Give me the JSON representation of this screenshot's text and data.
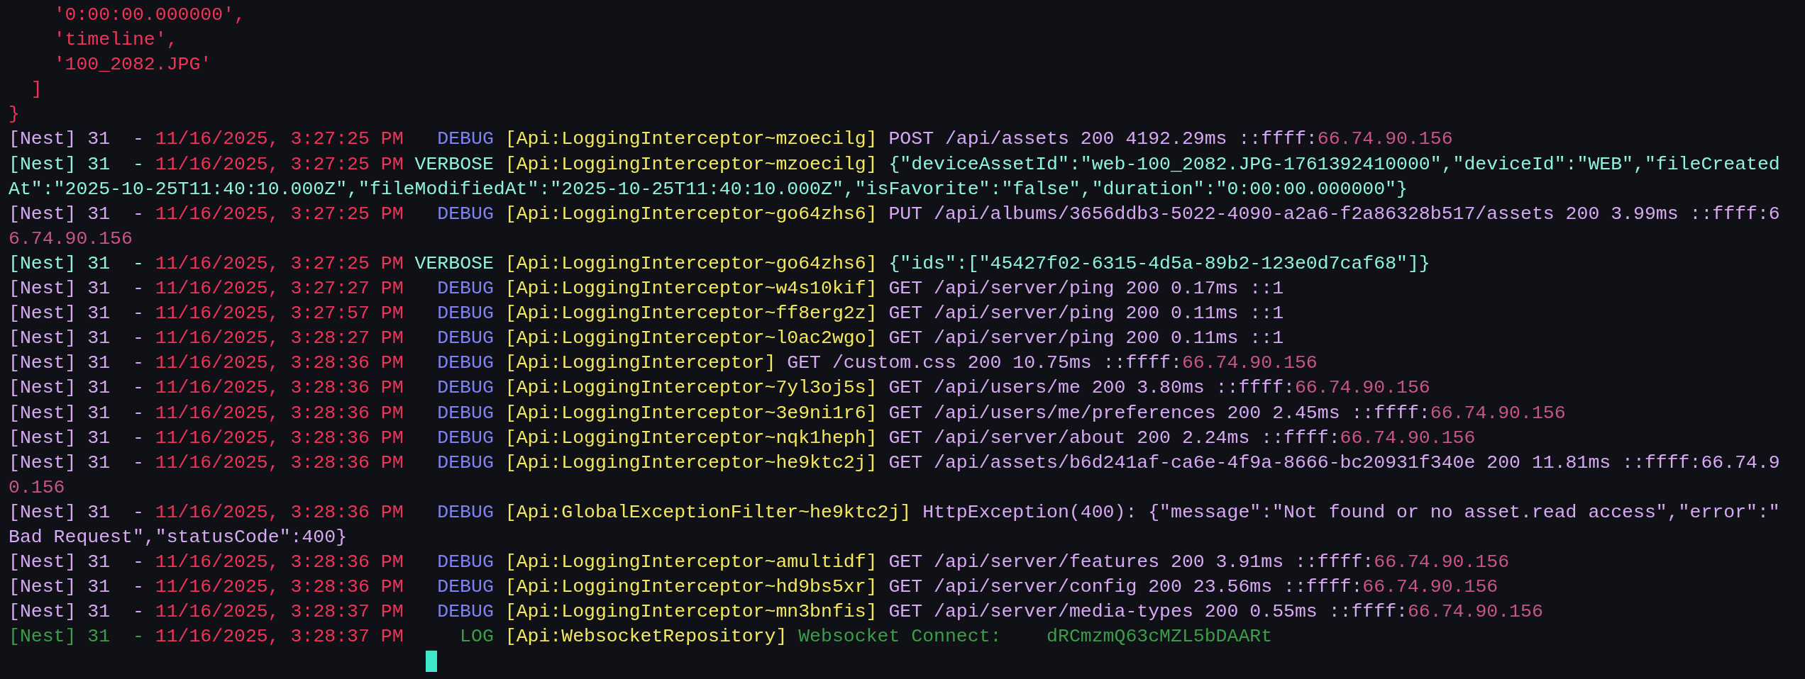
{
  "prelude": [
    "    '0:00:00.000000',",
    "    'timeline',",
    "    '100_2082.JPG'",
    "  ]",
    "}"
  ],
  "entries": [
    {
      "kind": "debug",
      "source": "[Nest] 31  -",
      "timestamp": "11/16/2025, 3:27:25 PM",
      "level": "DEBUG",
      "context": "[Api:LoggingInterceptor~mzoecilg]",
      "message": "POST /api/assets 200 4192.29ms ::ffff:",
      "ip": "66.74.90.156"
    },
    {
      "kind": "verbose",
      "source": "[Nest] 31  -",
      "timestamp": "11/16/2025, 3:27:25 PM",
      "level": "VERBOSE",
      "context": "[Api:LoggingInterceptor~mzoecilg]",
      "message": "{\"deviceAssetId\":\"web-100_2082.JPG-1761392410000\",\"deviceId\":\"WEB\",\"fileCreated",
      "continuation": "At\":\"2025-10-25T11:40:10.000Z\",\"fileModifiedAt\":\"2025-10-25T11:40:10.000Z\",\"isFavorite\":\"false\",\"duration\":\"0:00:00.000000\"}"
    },
    {
      "kind": "debug",
      "source": "[Nest] 31  -",
      "timestamp": "11/16/2025, 3:27:25 PM",
      "level": "DEBUG",
      "context": "[Api:LoggingInterceptor~go64zhs6]",
      "message": "PUT /api/albums/3656ddb3-5022-4090-a2a6-f2a86328b517/assets 200 3.99ms ::ffff:6",
      "ip": "6.74.90.156"
    },
    {
      "kind": "verbose",
      "source": "[Nest] 31  -",
      "timestamp": "11/16/2025, 3:27:25 PM",
      "level": "VERBOSE",
      "context": "[Api:LoggingInterceptor~go64zhs6]",
      "message": "{\"ids\":[\"45427f02-6315-4d5a-89b2-123e0d7caf68\"]}"
    },
    {
      "kind": "debug",
      "source": "[Nest] 31  -",
      "timestamp": "11/16/2025, 3:27:27 PM",
      "level": "DEBUG",
      "context": "[Api:LoggingInterceptor~w4s10kif]",
      "message": "GET /api/server/ping 200 0.17ms ::1"
    },
    {
      "kind": "debug",
      "source": "[Nest] 31  -",
      "timestamp": "11/16/2025, 3:27:57 PM",
      "level": "DEBUG",
      "context": "[Api:LoggingInterceptor~ff8erg2z]",
      "message": "GET /api/server/ping 200 0.11ms ::1"
    },
    {
      "kind": "debug",
      "source": "[Nest] 31  -",
      "timestamp": "11/16/2025, 3:28:27 PM",
      "level": "DEBUG",
      "context": "[Api:LoggingInterceptor~l0ac2wgo]",
      "message": "GET /api/server/ping 200 0.11ms ::1"
    },
    {
      "kind": "debug",
      "source": "[Nest] 31  -",
      "timestamp": "11/16/2025, 3:28:36 PM",
      "level": "DEBUG",
      "context": "[Api:LoggingInterceptor]",
      "message": "GET /custom.css 200 10.75ms ::ffff:",
      "ip": "66.74.90.156"
    },
    {
      "kind": "debug",
      "source": "[Nest] 31  -",
      "timestamp": "11/16/2025, 3:28:36 PM",
      "level": "DEBUG",
      "context": "[Api:LoggingInterceptor~7yl3oj5s]",
      "message": "GET /api/users/me 200 3.80ms ::ffff:",
      "ip": "66.74.90.156"
    },
    {
      "kind": "debug",
      "source": "[Nest] 31  -",
      "timestamp": "11/16/2025, 3:28:36 PM",
      "level": "DEBUG",
      "context": "[Api:LoggingInterceptor~3e9ni1r6]",
      "message": "GET /api/users/me/preferences 200 2.45ms ::ffff:",
      "ip": "66.74.90.156"
    },
    {
      "kind": "debug",
      "source": "[Nest] 31  -",
      "timestamp": "11/16/2025, 3:28:36 PM",
      "level": "DEBUG",
      "context": "[Api:LoggingInterceptor~nqk1heph]",
      "message": "GET /api/server/about 200 2.24ms ::ffff:",
      "ip": "66.74.90.156"
    },
    {
      "kind": "debug",
      "source": "[Nest] 31  -",
      "timestamp": "11/16/2025, 3:28:36 PM",
      "level": "DEBUG",
      "context": "[Api:LoggingInterceptor~he9ktc2j]",
      "message": "GET /api/assets/b6d241af-ca6e-4f9a-8666-bc20931f340e 200 11.81ms ::ffff:66.74.9",
      "ip": "0.156"
    },
    {
      "kind": "debug",
      "source": "[Nest] 31  -",
      "timestamp": "11/16/2025, 3:28:36 PM",
      "level": "DEBUG",
      "context": "[Api:GlobalExceptionFilter~he9ktc2j]",
      "message": "HttpException(400): {\"message\":\"Not found or no asset.read access\",\"error\":\"",
      "continuation": "Bad Request\",\"statusCode\":400}"
    },
    {
      "kind": "debug",
      "source": "[Nest] 31  -",
      "timestamp": "11/16/2025, 3:28:36 PM",
      "level": "DEBUG",
      "context": "[Api:LoggingInterceptor~amultidf]",
      "message": "GET /api/server/features 200 3.91ms ::ffff:",
      "ip": "66.74.90.156"
    },
    {
      "kind": "debug",
      "source": "[Nest] 31  -",
      "timestamp": "11/16/2025, 3:28:36 PM",
      "level": "DEBUG",
      "context": "[Api:LoggingInterceptor~hd9bs5xr]",
      "message": "GET /api/server/config 200 23.56ms ::ffff:",
      "ip": "66.74.90.156"
    },
    {
      "kind": "debug",
      "source": "[Nest] 31  -",
      "timestamp": "11/16/2025, 3:28:37 PM",
      "level": "DEBUG",
      "context": "[Api:LoggingInterceptor~mn3bnfis]",
      "message": "GET /api/server/media-types 200 0.55ms ::ffff:",
      "ip": "66.74.90.156"
    },
    {
      "kind": "log",
      "source": "[Nest] 31  -",
      "timestamp": "11/16/2025, 3:28:37 PM",
      "level": "LOG",
      "context": "[Api:WebsocketRepository]",
      "message": "Websocket Connect:    dRCmzmQ63cMZL5bDAARt"
    }
  ]
}
